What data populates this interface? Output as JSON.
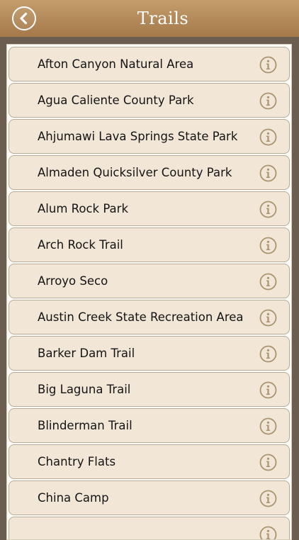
{
  "header": {
    "title": "Trails",
    "back_icon": "back-arrow-icon"
  },
  "colors": {
    "header_top": "#c49d6c",
    "header_bottom": "#a5794a",
    "background": "#6b5d4f",
    "row_fill": "#f2e6d7",
    "row_border": "#b8ab97",
    "info_icon": "#a9946f"
  },
  "trails": [
    {
      "label": "Afton Canyon Natural Area"
    },
    {
      "label": "Agua Caliente County Park"
    },
    {
      "label": "Ahjumawi Lava Springs State Park"
    },
    {
      "label": "Almaden Quicksilver County Park"
    },
    {
      "label": "Alum Rock Park"
    },
    {
      "label": "Arch Rock Trail"
    },
    {
      "label": "Arroyo Seco"
    },
    {
      "label": "Austin Creek State Recreation Area"
    },
    {
      "label": "Barker Dam Trail"
    },
    {
      "label": "Big Laguna Trail"
    },
    {
      "label": "Blinderman Trail"
    },
    {
      "label": "Chantry Flats"
    },
    {
      "label": "China Camp"
    },
    {
      "label": ""
    }
  ],
  "row_icon": "info-icon"
}
